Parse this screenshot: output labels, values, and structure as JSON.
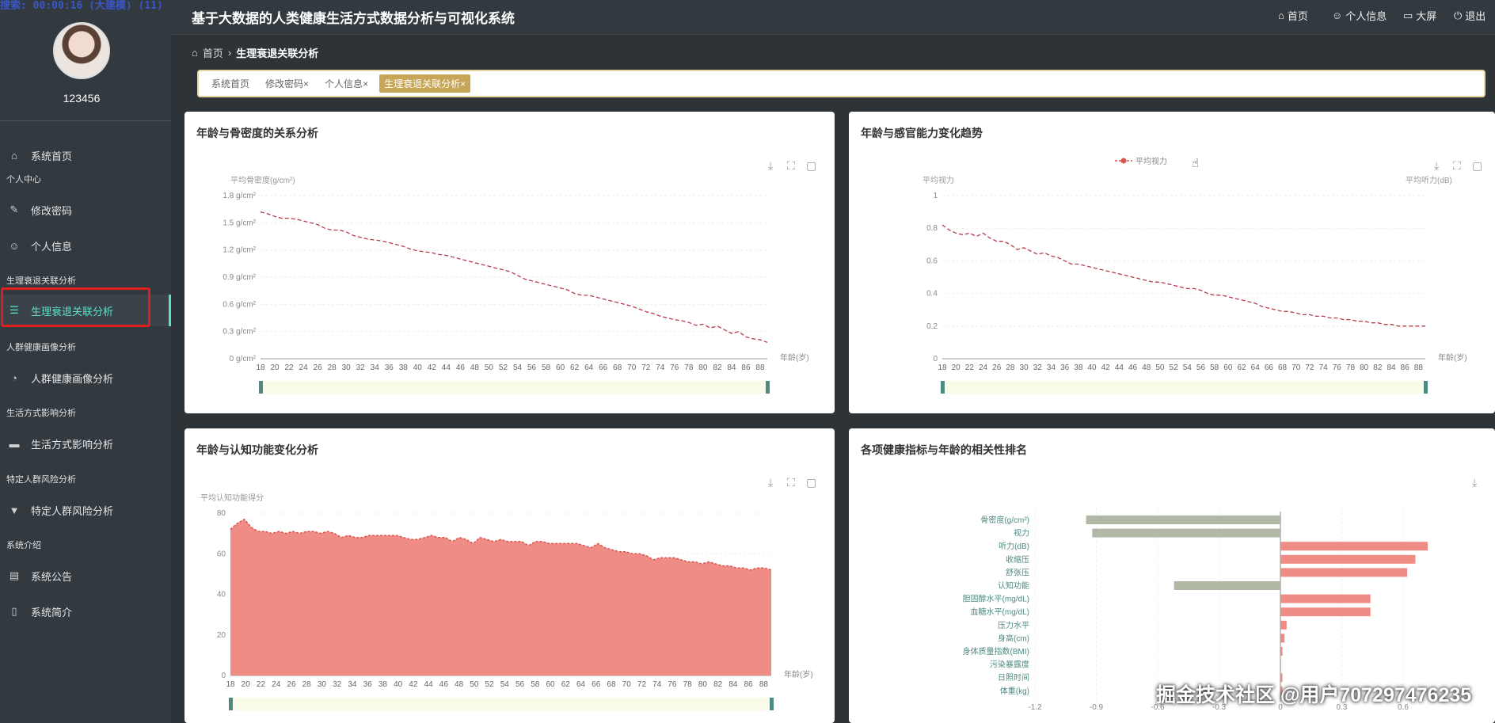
{
  "recording": "搜索: 00:00:16 (大建模) (11)",
  "user": {
    "name": "123456"
  },
  "app": {
    "title": "基于大数据的人类健康生活方式数据分析与可视化系统"
  },
  "header_nav": [
    {
      "label": "首页",
      "icon": "home-icon"
    },
    {
      "label": "个人信息",
      "icon": "user-icon"
    },
    {
      "label": "大屏",
      "icon": "monitor-icon"
    },
    {
      "label": "退出",
      "icon": "power-icon"
    }
  ],
  "sidebar": {
    "home": "系统首页",
    "g1": "个人中心",
    "change_pw": "修改密码",
    "profile": "个人信息",
    "g2": "生理衰退关联分析",
    "physio": "生理衰退关联分析",
    "g3": "人群健康画像分析",
    "portrait": "人群健康画像分析",
    "g4": "生活方式影响分析",
    "lifestyle": "生活方式影响分析",
    "g5": "特定人群风险分析",
    "risk": "特定人群风险分析",
    "g6": "系统介绍",
    "notice": "系统公告",
    "intro": "系统简介"
  },
  "breadcrumb": {
    "home": "首页",
    "current": "生理衰退关联分析"
  },
  "tabs": [
    "系统首页",
    "修改密码",
    "个人信息",
    "生理衰退关联分析"
  ],
  "charts": {
    "c1": {
      "title": "年龄与骨密度的关系分析",
      "ylabel": "平均骨密度(g/cm²)",
      "xunit": "年龄(岁)",
      "yticks": [
        "1.8 g/cm²",
        "1.5 g/cm²",
        "1.2 g/cm²",
        "0.9 g/cm²",
        "0.6 g/cm²",
        "0.3 g/cm²",
        "0 g/cm²"
      ]
    },
    "c2": {
      "title": "年龄与感官能力变化趋势",
      "ylabel_left": "平均视力",
      "ylabel_right": "平均听力(dB)",
      "legend": "平均视力",
      "xunit": "年龄(岁)",
      "yticks": [
        "1",
        "0.8",
        "0.6",
        "0.4",
        "0.2",
        "0"
      ]
    },
    "c3": {
      "title": "年龄与认知功能变化分析",
      "ylabel": "平均认知功能得分",
      "xunit": "年龄(岁)",
      "yticks": [
        "80",
        "60",
        "40",
        "20",
        "0"
      ]
    },
    "c4": {
      "title": "各项健康指标与年龄的相关性排名",
      "xticks": [
        "-1.2",
        "-0.9",
        "-0.6",
        "-0.3",
        "0",
        "0.3",
        "0.6"
      ]
    }
  },
  "chart_data": [
    {
      "type": "line",
      "title": "年龄与骨密度的关系分析",
      "ylabel": "平均骨密度(g/cm²)",
      "xlabel": "年龄(岁)",
      "ylim": [
        0,
        1.8
      ],
      "x_range": [
        18,
        89
      ],
      "series": [
        {
          "values": [
            1.62,
            1.6,
            1.57,
            1.55,
            1.55,
            1.54,
            1.52,
            1.5,
            1.48,
            1.44,
            1.42,
            1.42,
            1.4,
            1.36,
            1.34,
            1.32,
            1.31,
            1.3,
            1.28,
            1.26,
            1.24,
            1.21,
            1.19,
            1.18,
            1.17,
            1.15,
            1.14,
            1.12,
            1.1,
            1.08,
            1.06,
            1.04,
            1.02,
            1.0,
            0.98,
            0.96,
            0.92,
            0.88,
            0.86,
            0.84,
            0.82,
            0.8,
            0.78,
            0.76,
            0.72,
            0.7,
            0.7,
            0.68,
            0.66,
            0.64,
            0.62,
            0.6,
            0.58,
            0.55,
            0.52,
            0.5,
            0.47,
            0.45,
            0.43,
            0.42,
            0.4,
            0.37,
            0.38,
            0.34,
            0.36,
            0.32,
            0.28,
            0.3,
            0.24,
            0.22,
            0.21,
            0.18
          ]
        }
      ]
    },
    {
      "type": "line",
      "title": "年龄与感官能力变化趋势",
      "legend": [
        "平均视力"
      ],
      "ylabel": "平均视力",
      "xlabel": "年龄(岁)",
      "ylim": [
        0,
        1
      ],
      "x_range": [
        18,
        89
      ],
      "series": [
        {
          "name": "平均视力",
          "values": [
            0.82,
            0.79,
            0.77,
            0.76,
            0.77,
            0.75,
            0.77,
            0.74,
            0.72,
            0.72,
            0.7,
            0.67,
            0.68,
            0.66,
            0.64,
            0.65,
            0.63,
            0.62,
            0.6,
            0.58,
            0.58,
            0.57,
            0.56,
            0.55,
            0.54,
            0.53,
            0.52,
            0.51,
            0.5,
            0.49,
            0.48,
            0.47,
            0.47,
            0.46,
            0.45,
            0.44,
            0.43,
            0.43,
            0.42,
            0.4,
            0.39,
            0.39,
            0.38,
            0.37,
            0.36,
            0.35,
            0.34,
            0.32,
            0.31,
            0.3,
            0.29,
            0.29,
            0.28,
            0.27,
            0.27,
            0.26,
            0.26,
            0.25,
            0.25,
            0.24,
            0.24,
            0.23,
            0.23,
            0.22,
            0.22,
            0.21,
            0.21,
            0.2,
            0.2,
            0.2,
            0.2,
            0.2
          ]
        }
      ]
    },
    {
      "type": "area",
      "title": "年龄与认知功能变化分析",
      "ylabel": "平均认知功能得分",
      "xlabel": "年龄(岁)",
      "ylim": [
        0,
        80
      ],
      "x_range": [
        18,
        89
      ],
      "series": [
        {
          "values": [
            72,
            75,
            77,
            73,
            71,
            71,
            70,
            71,
            70,
            71,
            70,
            71,
            71,
            70,
            71,
            70,
            68,
            69,
            68,
            68,
            69,
            69,
            69,
            69,
            69,
            68,
            67,
            67,
            68,
            69,
            68,
            68,
            66,
            68,
            67,
            65,
            68,
            67,
            66,
            67,
            66,
            66,
            66,
            64,
            66,
            66,
            65,
            65,
            65,
            65,
            65,
            64,
            63,
            65,
            63,
            62,
            61,
            61,
            60,
            60,
            59,
            57,
            58,
            58,
            58,
            57,
            56,
            56,
            55,
            56,
            55,
            54,
            54,
            53,
            53,
            52,
            53,
            53,
            52
          ]
        }
      ]
    },
    {
      "type": "bar",
      "orientation": "horizontal",
      "title": "各项健康指标与年龄的相关性排名",
      "xlim": [
        -1.2,
        0.6
      ],
      "categories": [
        "骨密度(g/cm²)",
        "视力",
        "听力(dB)",
        "收缩压",
        "舒张压",
        "认知功能",
        "胆固醇水平(mg/dL)",
        "血糖水平(mg/dL)",
        "压力水平",
        "身高(cm)",
        "身体质量指数(BMI)",
        "污染暴露度",
        "日照时间",
        "体重(kg)"
      ],
      "values": [
        -0.95,
        -0.92,
        0.72,
        0.66,
        0.62,
        -0.52,
        0.44,
        0.44,
        0.03,
        0.02,
        0.01,
        0.0,
        0.01,
        0.01
      ],
      "colors": {
        "positive": "#f08c86",
        "negative": "#b2b8a6"
      }
    }
  ],
  "watermark": "掘金技术社区 @用户707297476235"
}
